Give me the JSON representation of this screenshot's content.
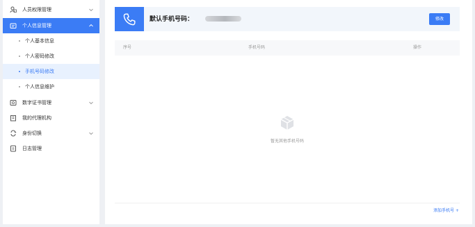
{
  "sidebar": {
    "items": [
      {
        "label": "人员权限管理",
        "icon": "users-lock-icon",
        "chevron": "chevron-down-icon"
      },
      {
        "label": "个人信息管理",
        "icon": "id-card-icon",
        "chevron": "chevron-up-icon"
      },
      {
        "label": "数字证书管理",
        "icon": "certificate-icon",
        "chevron": "chevron-down-icon"
      },
      {
        "label": "我的代理机构",
        "icon": "agency-icon"
      },
      {
        "label": "身份切换",
        "icon": "switch-identity-icon",
        "chevron": "chevron-down-icon"
      },
      {
        "label": "日志管理",
        "icon": "log-icon"
      }
    ],
    "sub_items": [
      {
        "label": "个人基本信息"
      },
      {
        "label": "个人密码修改"
      },
      {
        "label": "手机号码修改"
      },
      {
        "label": "个人信息维护"
      }
    ]
  },
  "main": {
    "phone_title": "默认手机号码：",
    "edit_label": "修改",
    "table": {
      "columns": [
        "序号",
        "手机号码",
        "操作"
      ]
    },
    "empty_text": "暂无其他手机号码",
    "add_label": "添加手机号 +"
  },
  "colors": {
    "primary": "#3b7cf5",
    "selected_bg": "#e8f1fe",
    "page_bg": "#eef0f4"
  }
}
